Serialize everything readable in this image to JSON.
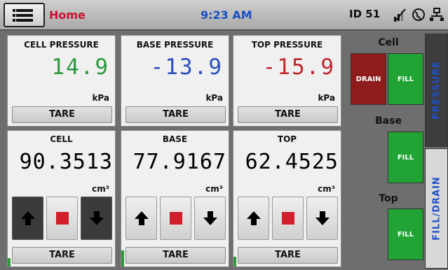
{
  "topbar": {
    "menu_icon": "menu-icon",
    "title": "Home",
    "time": "9:23 AM",
    "device_id": "ID 51",
    "status_icons": [
      "no-signal-icon",
      "globe-icon",
      "network-icon"
    ]
  },
  "pressures": [
    {
      "title": "CELL PRESSURE",
      "value": "14.9",
      "unit": "kPa",
      "tare": "TARE",
      "color": "#2a9a3c"
    },
    {
      "title": "BASE PRESSURE",
      "value": "-13.9",
      "unit": "kPa",
      "tare": "TARE",
      "color": "#2a4fc0"
    },
    {
      "title": "TOP PRESSURE",
      "value": "-15.9",
      "unit": "kPa",
      "tare": "TARE",
      "color": "#c0262e"
    }
  ],
  "volumes": [
    {
      "title": "CELL",
      "value": "90.3513",
      "unit": "cm³",
      "tare": "TARE",
      "level_fraction": 0.06,
      "controls": [
        "up-arrow-icon",
        "stop-icon",
        "down-arrow-icon"
      ]
    },
    {
      "title": "BASE",
      "value": "77.9167",
      "unit": "cm³",
      "tare": "TARE",
      "level_fraction": 0.12,
      "controls": [
        "up-arrow-icon",
        "stop-icon",
        "down-arrow-icon"
      ]
    },
    {
      "title": "TOP",
      "value": "62.4525",
      "unit": "cm³",
      "tare": "TARE",
      "level_fraction": 0.07,
      "controls": [
        "up-arrow-icon",
        "stop-icon",
        "down-arrow-icon"
      ]
    }
  ],
  "side": {
    "cell_label": "Cell",
    "base_label": "Base",
    "top_label": "Top",
    "drain": "DRAIN",
    "fill": "FILL",
    "tab_pressure": "PRESSURE",
    "tab_filldrain": "FILL/DRAIN"
  },
  "colors": {
    "accent_red": "#c8102e",
    "accent_blue": "#1a4fc4",
    "valve_green": "#21a336",
    "valve_red": "#8e1c1c"
  }
}
